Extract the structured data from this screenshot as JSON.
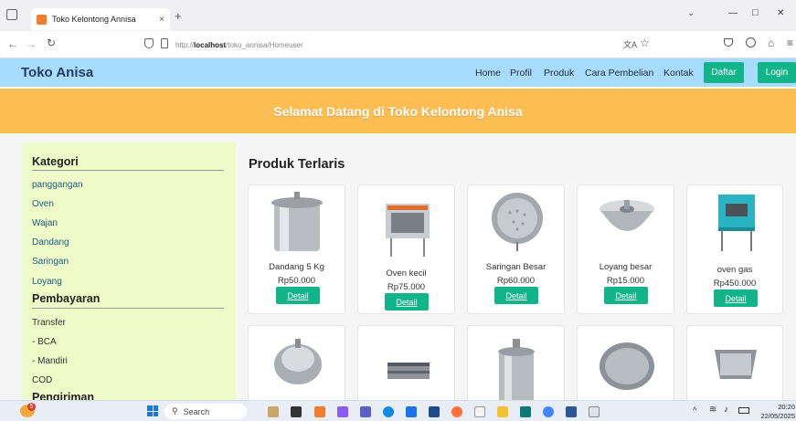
{
  "browser": {
    "tab_title": "Toko Kelontong Annisa",
    "tab_close": "×",
    "new_tab": "+",
    "url_prefix": "http://",
    "url_host": "localhost",
    "url_path": "/toko_annisa/Homeuser",
    "min": "—",
    "max": "□",
    "close": "✕"
  },
  "site": {
    "brand": "Toko Anisa",
    "nav": [
      "Home",
      "Profil",
      "Produk",
      "Cara Pembelian",
      "Kontak"
    ],
    "daftar": "Daftar",
    "login": "Login",
    "banner": "Selamat Datang di Toko Kelontong Anisa"
  },
  "sidebar": {
    "kategori_title": "Kategori",
    "kategori": [
      "panggangan",
      "Oven",
      "Wajan",
      "Dandang",
      "Saringan",
      "Loyang"
    ],
    "pembayaran_title": "Pembayaran",
    "pembayaran": [
      "Transfer",
      "- BCA",
      "- Mandiri",
      "COD"
    ],
    "pengiriman_title": "Pengiriman"
  },
  "products": {
    "title": "Produk Terlaris",
    "detail_label": "Detail",
    "items": [
      {
        "name": "Dandang 5 Kg",
        "price": "Rp50.000"
      },
      {
        "name": "Oven kecil",
        "price": "Rp75.000"
      },
      {
        "name": "Saringan Besar",
        "price": "Rp60.000"
      },
      {
        "name": "Loyang besar",
        "price": "Rp15.000"
      },
      {
        "name": "oven gas",
        "price": "Rp450.000"
      }
    ]
  },
  "taskbar": {
    "search": "Search",
    "notif_count": "5",
    "time": "20:20",
    "date": "22/05/2025"
  },
  "colors": {
    "header": "#a8dcff",
    "banner": "#fcbd52",
    "accent": "#12b48a",
    "sidebar": "#eefac7"
  }
}
